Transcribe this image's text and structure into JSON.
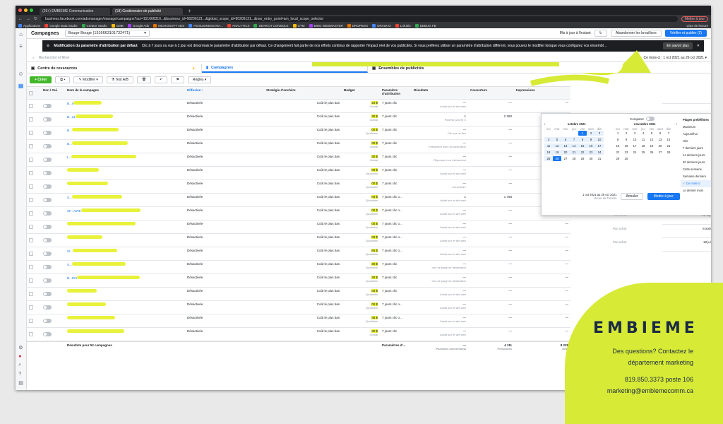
{
  "browser": {
    "tabs": [
      "(26+) EMBIEME Communication",
      "(18) Gestionnaire de publicité"
    ],
    "url": "business.facebook.com/adsmanager/manage/campaigns?act=151666310...&business_id=90206121...&global_scope_id=90206121...&nav_entry_point=am_local_scope_selector",
    "update_label": "Mettre à jour",
    "bookmarks": [
      "Applications",
      "Google Data Studio",
      "Creator Studio",
      "GMB",
      "Google Ads",
      "MICROSOFT ADS",
      "FB BUSINESS MA...",
      "ANALYTICS",
      "SEARCH CONSOLE",
      "GTM",
      "BING WEBMASTER",
      "DROPBOX",
      "DRAW.IO",
      "Lnk.Bio",
      "DEBUG FB"
    ],
    "reading_list": "Liste de lecture"
  },
  "header": {
    "title": "Campagnes",
    "account": "Bouge Bouge (1516663101732471)",
    "updated": "Mis à jour à l'instant",
    "discard": "Abandonner les brouillons",
    "publish": "Vérifier et publier (2)"
  },
  "banner": {
    "title": "Modification du paramètre d'attribution par défaut",
    "text": "Clic à 7 jours ou vue à 1 jour est désormais le paramètre d'attribution par défaut. Ce changement fait partie de nos efforts continus de rapporter l'impact réel de vos publicités. Si vous préférez utiliser un paramètre d'attribution différent, vous pouvez le modifier lorsque vous configurez vos ensembles d...",
    "learn": "En savoir plus"
  },
  "search": {
    "placeholder": "Rechercher et filtrer",
    "date_range": "Ce mois-ci : 1 oct 2021 au 26 oct 2021"
  },
  "tabs": {
    "resources": "Centre de ressources",
    "campaigns": "Campagnes",
    "adsets": "Ensembles de publicités"
  },
  "toolbar": {
    "create": "+ Créer",
    "edit": "Modifier",
    "test": "Test A/B",
    "rules": "Règles"
  },
  "columns": [
    "Non / Oui",
    "Nom de la campagne",
    "Diffusion ↑",
    "Stratégie d'enchère",
    "Budget",
    "Paramètre d'attribution",
    "Résultats",
    "Couverture",
    "Impressions"
  ],
  "rows": [
    {
      "name": "B...n",
      "delivery": "Désactivée",
      "bid": "Coût le plus bas",
      "budget": "20 $",
      "budget_sub": "Global",
      "attr": "7 jours clic",
      "result": "—",
      "result_sub": "Achat sur le site web",
      "reach": "—",
      "impr": "—"
    },
    {
      "name": "B...21",
      "delivery": "Désactivée",
      "bid": "Coût le plus bas",
      "budget": "30 $",
      "budget_sub": "Global",
      "attr": "7 jours clic",
      "result": "1",
      "result_sub": "Parents (2019) X",
      "reach": "2 360",
      "impr": ""
    },
    {
      "name": "B...",
      "delivery": "Désactivée",
      "bid": "Coût le plus bas",
      "budget": "00 $",
      "budget_sub": "Quotidien",
      "attr": "7 jours clic",
      "result": "—",
      "result_sub": "Clic sur un lien",
      "reach": "—",
      "impr": ""
    },
    {
      "name": "B...",
      "delivery": "Désactivée",
      "bid": "Coût le plus bas",
      "budget": "00 $",
      "budget_sub": "Global",
      "attr": "7 jours clic",
      "result": "—",
      "result_sub": "Interaction avec la publication",
      "reach": "—",
      "impr": ""
    },
    {
      "name": "L...",
      "delivery": "Désactivée",
      "bid": "Coût le plus bas",
      "budget": "30 $",
      "budget_sub": "Global",
      "attr": "7 jours clic",
      "result": "—",
      "result_sub": "Réponse à un événement",
      "reach": "—",
      "impr": "—"
    },
    {
      "name": "",
      "delivery": "Désactivée",
      "bid": "Coût le plus bas",
      "budget": "00 $",
      "budget_sub": "Quotidien",
      "attr": "7 jours clic",
      "result": "—",
      "result_sub": "Achat sur le site web",
      "reach": "—",
      "impr": "—"
    },
    {
      "name": "",
      "delivery": "Désactivée",
      "bid": "Coût le plus bas",
      "budget": "00 $",
      "budget_sub": "Quotidien",
      "attr": "7 jours clic",
      "result": "—",
      "result_sub": "Couverture",
      "reach": "—",
      "impr": "—"
    },
    {
      "name": "S...",
      "delivery": "Désactivée",
      "bid": "Coût le plus bas",
      "budget": "00 $",
      "budget_sub": "Quotidien",
      "attr": "7 jours clic o...",
      "result": "1",
      "result_sub": "Achat sur le site web",
      "reach": "1 758",
      "impr": "5 100"
    },
    {
      "name": "SF...AIRE",
      "delivery": "Désactivée",
      "bid": "Coût le plus bas",
      "budget": "00 $",
      "budget_sub": "Quotidien",
      "attr": "7 jours clic o...",
      "result": "—",
      "result_sub": "Achat sur le site web",
      "reach": "—",
      "impr": "—"
    },
    {
      "name": "",
      "delivery": "Désactivée",
      "bid": "Coût le plus bas",
      "budget": "00 $",
      "budget_sub": "Quotidien",
      "attr": "7 jours clic o...",
      "result": "—",
      "result_sub": "Achat sur le site web",
      "reach": "—",
      "impr": "—"
    },
    {
      "name": "",
      "delivery": "Désactivée",
      "bid": "Coût le plus bas",
      "budget": "00 $",
      "budget_sub": "Quotidien",
      "attr": "7 jours clic o...",
      "result": "—",
      "result_sub": "Achat sur le site web",
      "reach": "—",
      "impr": "—"
    },
    {
      "name": "Sl...",
      "delivery": "Désactivée",
      "bid": "Coût le plus bas",
      "budget": "65 $",
      "budget_sub": "Quotidien",
      "attr": "7 jours clic o...",
      "result": "—",
      "result_sub": "Achat sur le site web",
      "reach": "—",
      "impr": "—"
    },
    {
      "name": "S...",
      "delivery": "Désactivée",
      "bid": "Coût le plus bas",
      "budget": "30 $",
      "budget_sub": "Quotidien",
      "attr": "7 jours clic",
      "result": "—",
      "result_sub": "Vue de page de destination",
      "reach": "—",
      "impr": "—"
    },
    {
      "name": "B...021",
      "delivery": "Désactivée",
      "bid": "Coût le plus bas",
      "budget": "30 $",
      "budget_sub": "Quotidien",
      "attr": "7 jours clic",
      "result": "—",
      "result_sub": "Vue de page de destination",
      "reach": "—",
      "impr": "—"
    },
    {
      "name": "",
      "delivery": "Désactivée",
      "bid": "Coût le plus bas",
      "budget": "00 $",
      "budget_sub": "Quotidien",
      "attr": "7 jours clic",
      "result": "—",
      "result_sub": "Achat sur le site web",
      "reach": "—",
      "impr": "—"
    },
    {
      "name": "",
      "delivery": "Désactivée",
      "bid": "Coût le plus bas",
      "budget": "00 $",
      "budget_sub": "Quotidien",
      "attr": "7 jours clic o...",
      "result": "—",
      "result_sub": "Achat sur le site web",
      "reach": "—",
      "impr": "—"
    },
    {
      "name": "",
      "delivery": "Désactivée",
      "bid": "Coût le plus bas",
      "budget": "35 $",
      "budget_sub": "Quotidien",
      "attr": "7 jours clic o...",
      "result": "—",
      "result_sub": "Achat sur le site web",
      "reach": "—",
      "impr": "—"
    },
    {
      "name": "",
      "delivery": "Désactivée",
      "bid": "Coût le plus bas",
      "budget": "30 $",
      "budget_sub": "Global",
      "attr": "7 jours clic",
      "result": "—",
      "result_sub": "Achat sur le site web",
      "reach": "—",
      "impr": "—"
    }
  ],
  "totals": {
    "label": "Résultats pour 53 campagnes",
    "attr": "Paramètres d'...",
    "result": "—",
    "result_sub": "Plusieurs conversions",
    "reach": "4 111",
    "reach_sub": "Personnes",
    "impr": "8 228",
    "impr_sub": "Total"
  },
  "datepicker": {
    "compare": "Comparer",
    "left_month": "octobre 2021",
    "right_month": "novembre 2021",
    "daynames": [
      "lun",
      "mar",
      "mer",
      "jeu",
      "ven",
      "sam",
      "dim"
    ],
    "range": "1 oct 2021 au 26 oct 2021",
    "tz": "Heure de Toronto",
    "cancel": "Annuler",
    "update": "Mettre à jour",
    "presets_title": "Plages prédéfinies",
    "presets": [
      "Maximum",
      "Aujourd'hui",
      "Hier",
      "7 derniers jours",
      "14 derniers jours",
      "30 derniers jours",
      "Cette semaine",
      "Semaine dernière",
      "Ce mois-ci",
      "Le dernier mois"
    ]
  },
  "rightcol": [
    {
      "a": "",
      "b": ""
    },
    {
      "a": "",
      "b": ""
    },
    {
      "a": "",
      "b": ""
    },
    {
      "a": "",
      "b": ""
    },
    {
      "a": "Par réponse à l'événement",
      "b": "4 août 2021"
    },
    {
      "a": "Par achat",
      "b": "15 juil 2021"
    },
    {
      "a": "Pour 1 000 personnes touchées",
      "b": "30 sep 2021"
    },
    {
      "a": "1 $ Par achat",
      "b": "30 nov 2021"
    },
    {
      "a": "Par achat",
      "b": "23 sep 2021"
    },
    {
      "a": "Par achat",
      "b": "16 sep 2021"
    },
    {
      "a": "Par achat",
      "b": "8 août 2021"
    },
    {
      "a": "Par achat",
      "b": "18 juil 2021"
    }
  ],
  "promo": {
    "logo": "EMBIEME",
    "line1": "Des questions? Contactez le",
    "line2": "département marketing",
    "phone": "819.850.3373 poste 106",
    "email": "marketing@emblemecomm.ca"
  },
  "colors": {
    "accent": "#1877f2",
    "highlight": "#e8f23a",
    "promo_bg": "#d7ea36",
    "promo_text": "#1b2b45"
  }
}
